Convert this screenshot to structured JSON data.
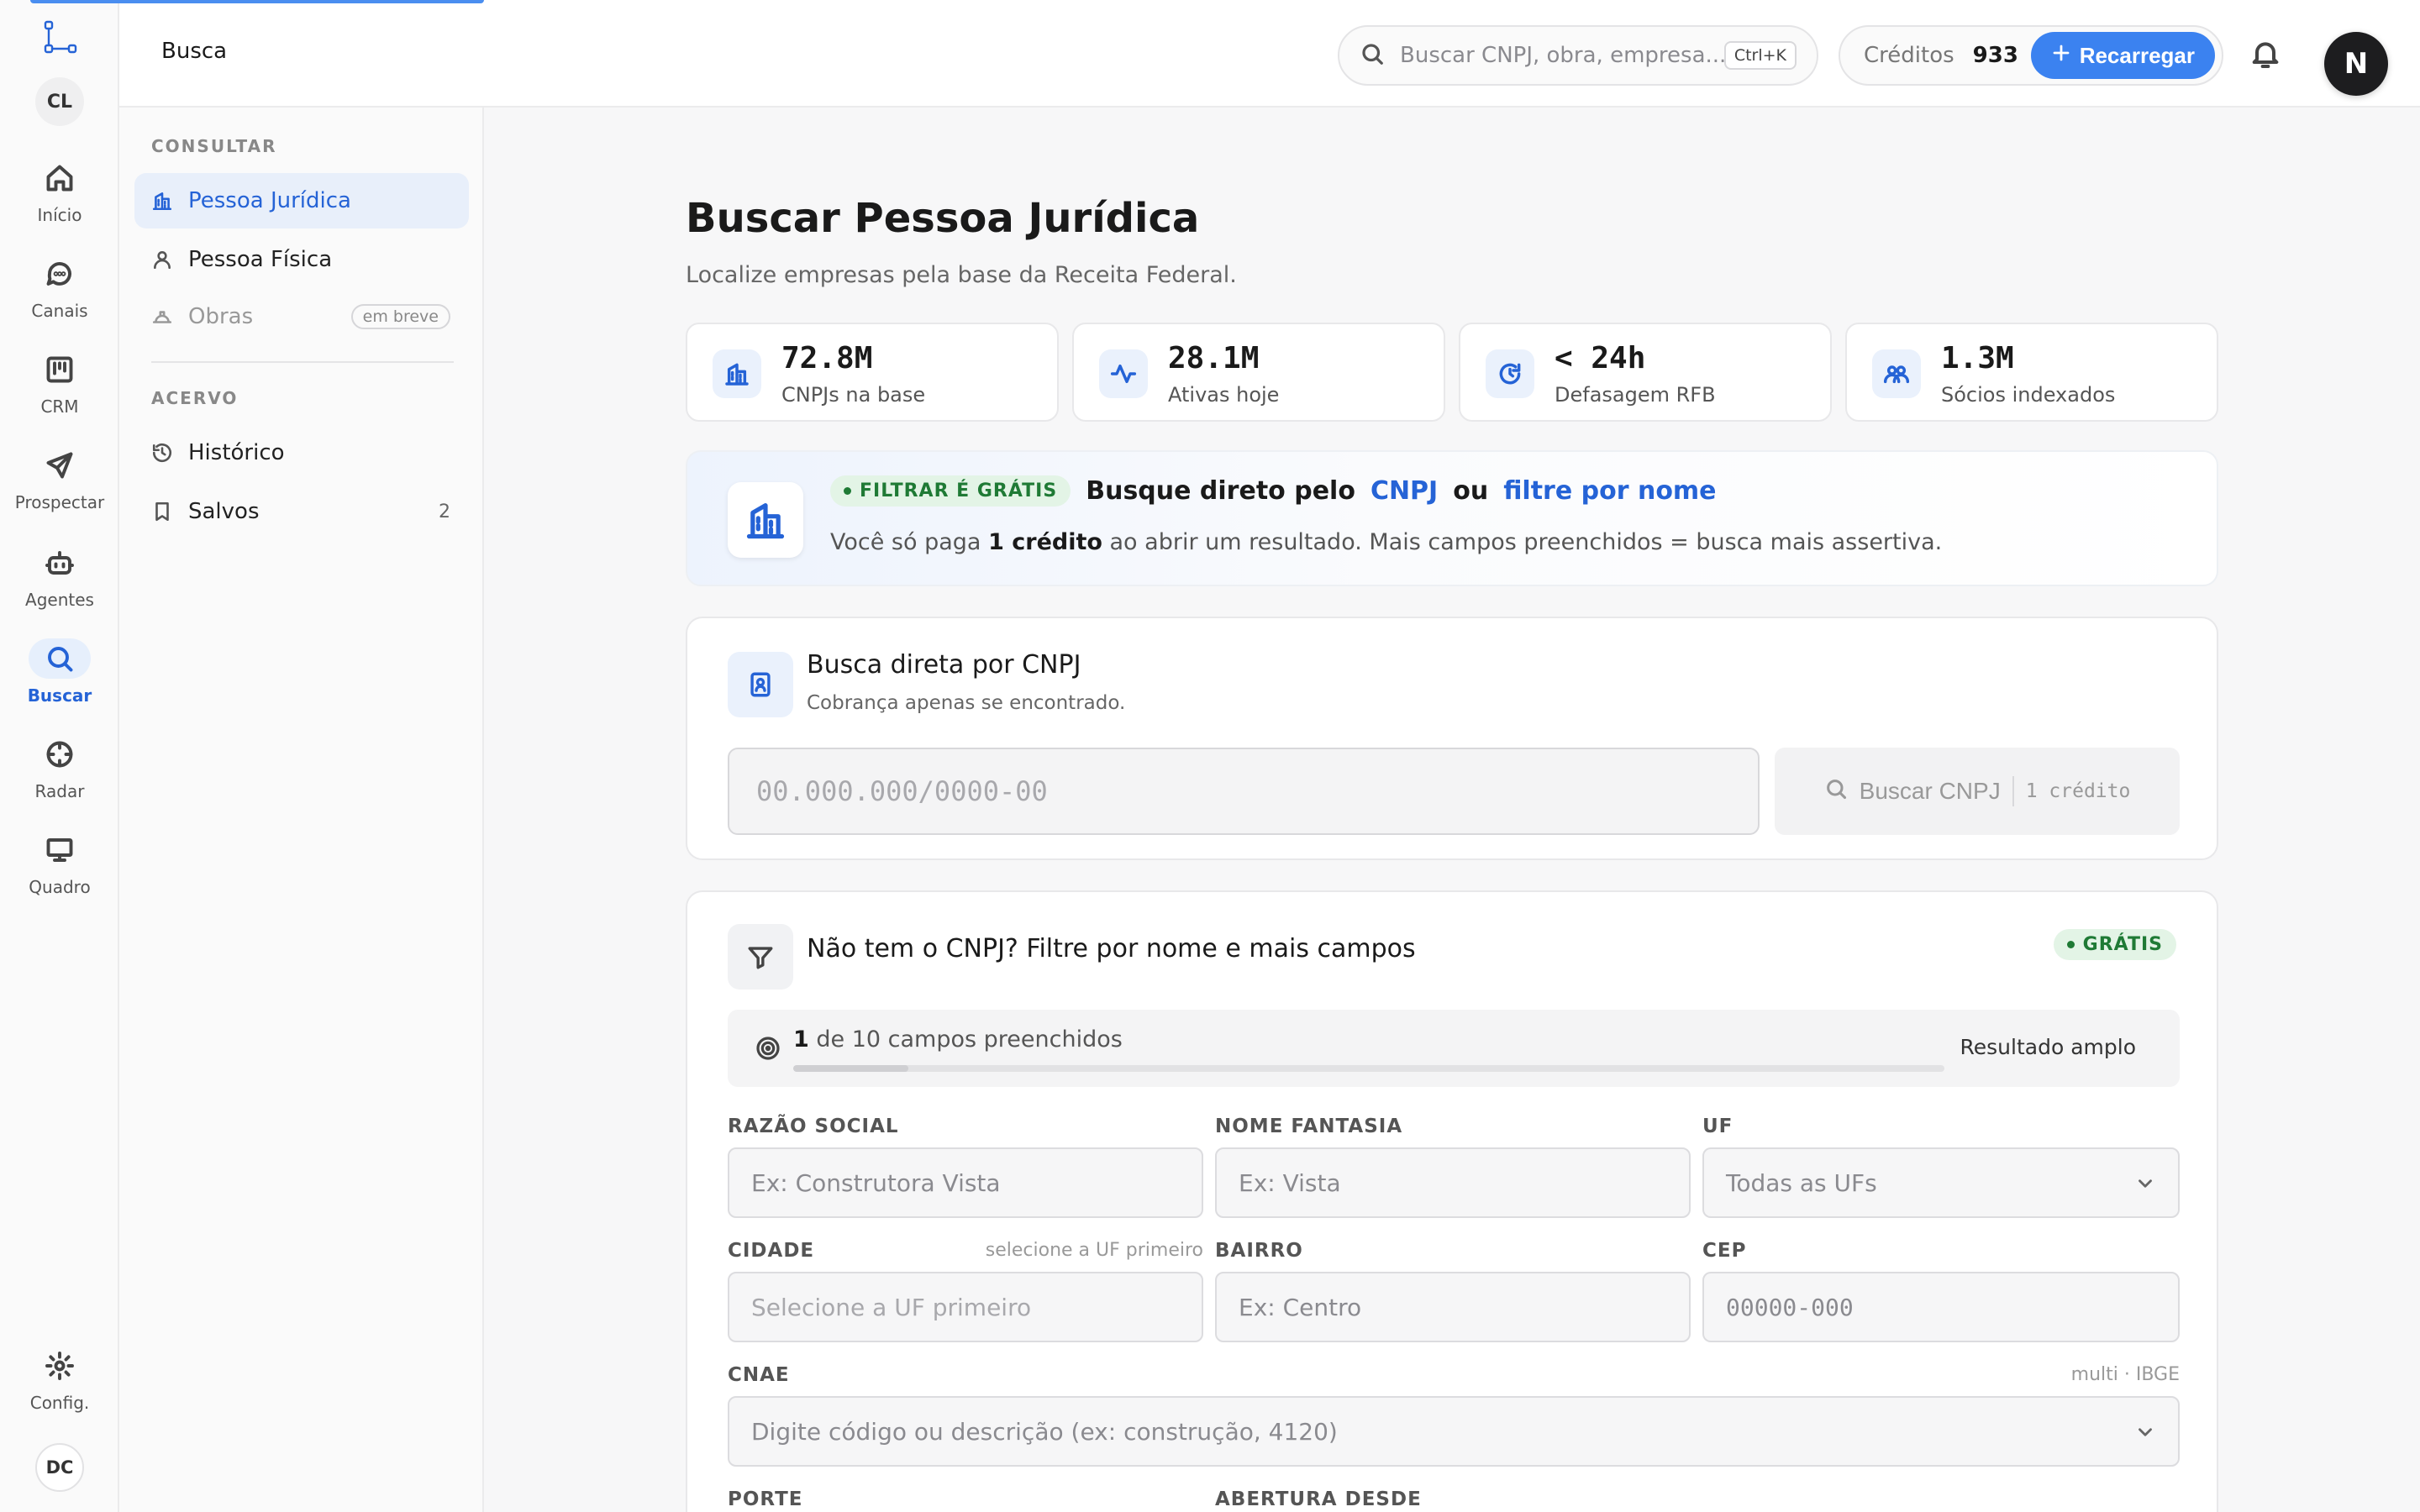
{
  "header": {
    "breadcrumb": "Busca",
    "search_placeholder": "Buscar CNPJ, obra, empresa...",
    "search_shortcut": "Ctrl+K",
    "credits_label": "Créditos",
    "credits_value": "933",
    "recharge_label": "Recarregar",
    "avatar_initial": "N"
  },
  "rail": {
    "workspace": "CL",
    "items": [
      {
        "label": "Início",
        "icon": "home-icon"
      },
      {
        "label": "Canais",
        "icon": "chat-icon"
      },
      {
        "label": "CRM",
        "icon": "kanban-icon"
      },
      {
        "label": "Prospectar",
        "icon": "send-icon"
      },
      {
        "label": "Agentes",
        "icon": "bot-icon"
      },
      {
        "label": "Buscar",
        "icon": "search-icon",
        "active": true
      },
      {
        "label": "Radar",
        "icon": "crosshair-icon"
      },
      {
        "label": "Quadro",
        "icon": "presentation-icon"
      }
    ],
    "settings_label": "Config.",
    "user_initials": "DC"
  },
  "subnav": {
    "section_consultar": "CONSULTAR",
    "pessoa_juridica": "Pessoa Jurídica",
    "pessoa_fisica": "Pessoa Física",
    "obras": "Obras",
    "obras_badge": "em breve",
    "section_acervo": "ACERVO",
    "historico": "Histórico",
    "salvos": "Salvos",
    "salvos_count": "2"
  },
  "main": {
    "title": "Buscar Pessoa Jurídica",
    "subtitle": "Localize empresas pela base da Receita Federal.",
    "stats": [
      {
        "value": "72.8M",
        "label": "CNPJs na base",
        "icon": "building-icon"
      },
      {
        "value": "28.1M",
        "label": "Ativas hoje",
        "icon": "activity-icon"
      },
      {
        "value": "< 24h",
        "label": "Defasagem RFB",
        "icon": "refresh-clock-icon"
      },
      {
        "value": "1.3M",
        "label": "Sócios indexados",
        "icon": "users-icon"
      }
    ],
    "promo": {
      "pill": "FILTRAR É GRÁTIS",
      "line1_a": "Busque direto pelo",
      "line1_link1": "CNPJ",
      "line1_b": "ou",
      "line1_link2": "filtre por nome",
      "line2_a": "Você só paga",
      "line2_bold": "1 crédito",
      "line2_b": "ao abrir um resultado. Mais campos preenchidos = busca mais assertiva."
    },
    "direct": {
      "title": "Busca direta por CNPJ",
      "subtitle": "Cobrança apenas se encontrado.",
      "input_placeholder": "00.000.000/0000-00",
      "button_label": "Buscar CNPJ",
      "button_cost": "1 crédito"
    },
    "filter": {
      "title": "Não tem o CNPJ? Filtre por nome e mais campos",
      "pill": "GRÁTIS",
      "progress_count": "1",
      "progress_text": "de 10 campos preenchidos",
      "progress_fraction": 0.1,
      "progress_result": "Resultado amplo",
      "fields": {
        "razao_label": "RAZÃO SOCIAL",
        "razao_placeholder": "Ex: Construtora Vista",
        "fantasia_label": "NOME FANTASIA",
        "fantasia_placeholder": "Ex: Vista",
        "uf_label": "UF",
        "uf_value": "Todas as UFs",
        "cidade_label": "CIDADE",
        "cidade_hint": "selecione a UF primeiro",
        "cidade_value": "Selecione a UF primeiro",
        "bairro_label": "BAIRRO",
        "bairro_placeholder": "Ex: Centro",
        "cep_label": "CEP",
        "cep_placeholder": "00000-000",
        "cnae_label": "CNAE",
        "cnae_hint": "multi · IBGE",
        "cnae_placeholder": "Digite código ou descrição (ex: construção, 4120)",
        "porte_label": "PORTE",
        "abertura_label": "ABERTURA DESDE"
      }
    }
  },
  "colors": {
    "accent": "#2563d6",
    "button": "#3b82f0",
    "success": "#1f7a35"
  }
}
